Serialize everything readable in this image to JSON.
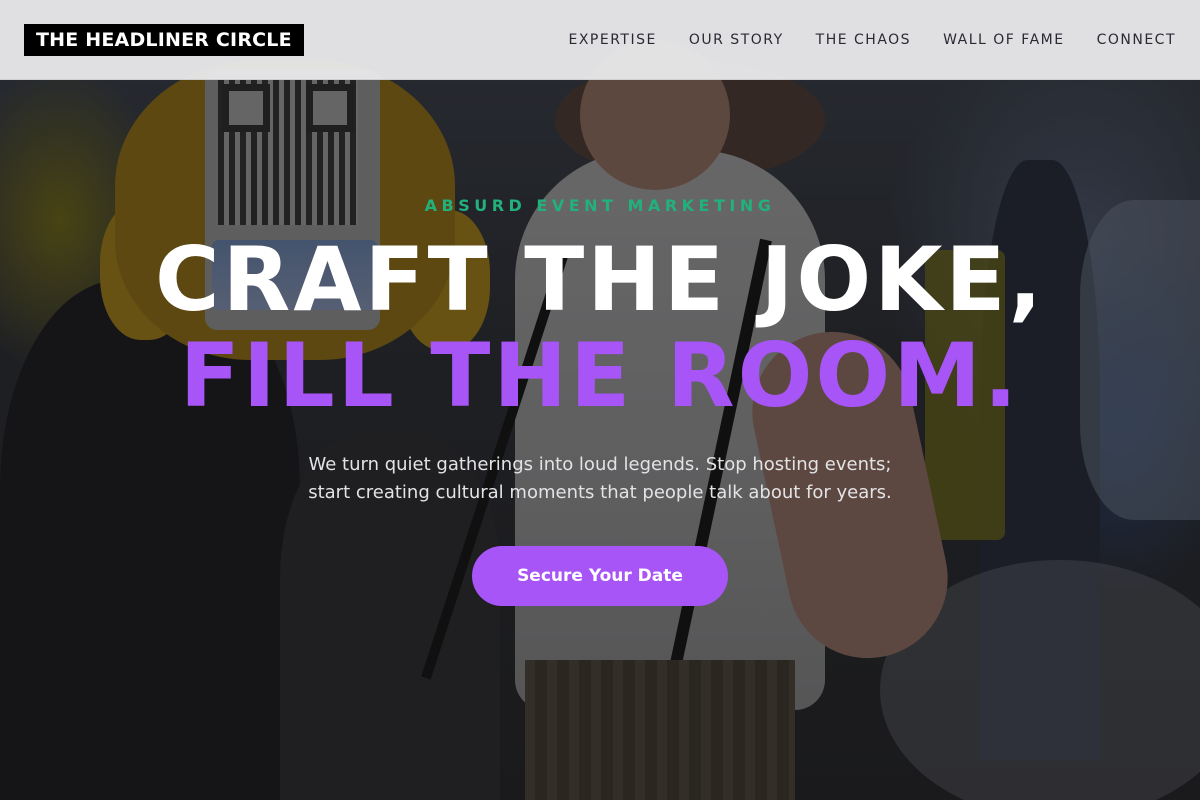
{
  "header": {
    "logo_text": "THE HEADLINER CIRCLE",
    "nav": [
      {
        "label": "EXPERTISE"
      },
      {
        "label": "OUR STORY"
      },
      {
        "label": "THE CHAOS"
      },
      {
        "label": "WALL OF FAME"
      },
      {
        "label": "CONNECT"
      }
    ]
  },
  "hero": {
    "eyebrow": "ABSURD EVENT MARKETING",
    "headline_line1": "CRAFT THE JOKE,",
    "headline_line2": "FILL THE ROOM.",
    "subtext_line1": "We turn quiet gatherings into loud legends. Stop hosting events;",
    "subtext_line2": "start creating cultural moments that people talk about for years.",
    "cta_label": "Secure Your Date"
  },
  "colors": {
    "accent": "#a855f7",
    "eyebrow": "#22b07d",
    "logo_bg": "#000000",
    "header_bg": "#e8e8ea"
  }
}
